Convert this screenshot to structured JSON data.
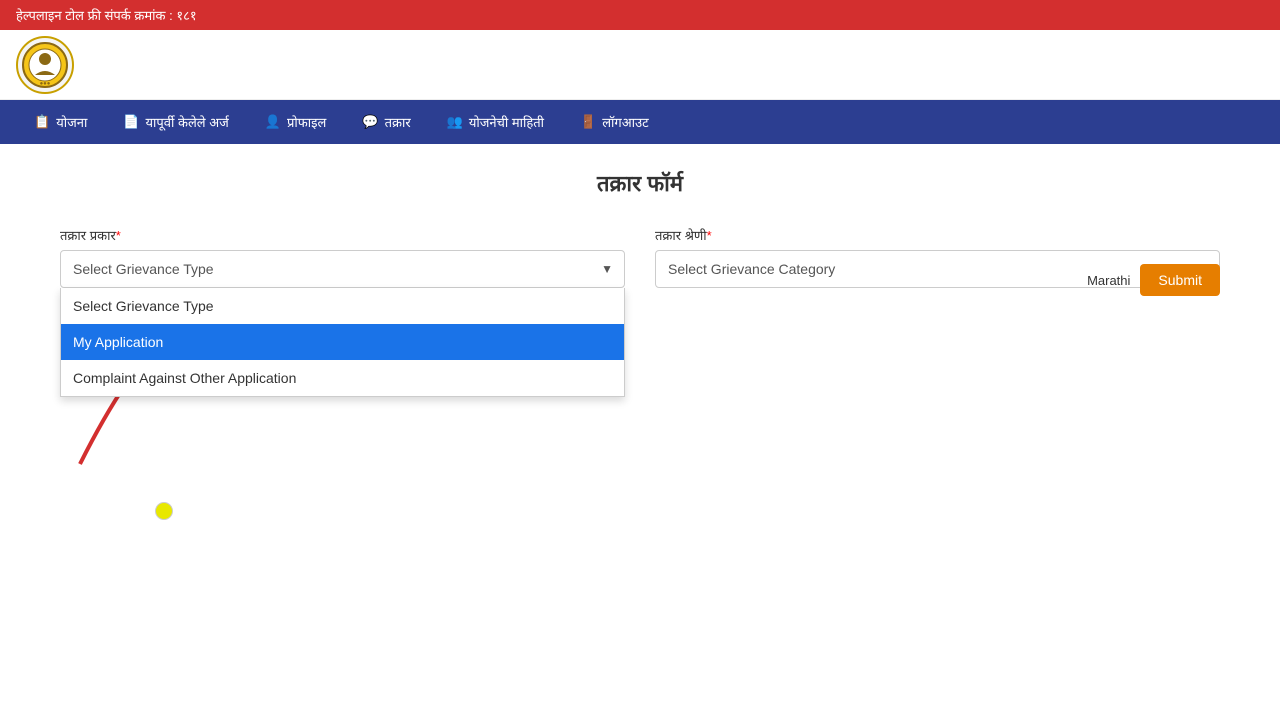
{
  "topBanner": {
    "text": "हेल्पलाइन टोल फ्री संपर्क क्रमांक : १८१"
  },
  "navbar": {
    "items": [
      {
        "icon": "📋",
        "label": "योजना"
      },
      {
        "icon": "📄",
        "label": "यापूर्वी केलेले अर्ज"
      },
      {
        "icon": "👤",
        "label": "प्रोफाइल"
      },
      {
        "icon": "💬",
        "label": "तक्रार"
      },
      {
        "icon": "👥",
        "label": "योजनेची माहिती"
      },
      {
        "icon": "🚪",
        "label": "लॉगआउट"
      }
    ]
  },
  "page": {
    "title": "तक्रार फॉर्म"
  },
  "form": {
    "grievanceTypeLabel": "तक्रार प्रकार",
    "grievanceCategoryLabel": "तक्रार श्रेणी",
    "grievanceTypePlaceholder": "Select Grievance Type",
    "grievanceCategoryPlaceholder": "Select Grievance Category",
    "dropdownOptions": [
      {
        "value": "",
        "label": "Select Grievance Type",
        "selected": false
      },
      {
        "value": "my_application",
        "label": "My Application",
        "selected": true
      },
      {
        "value": "complaint_other",
        "label": "Complaint Against Other Application",
        "selected": false
      }
    ],
    "languageLabel": "Marathi",
    "submitLabel": "Submit"
  }
}
